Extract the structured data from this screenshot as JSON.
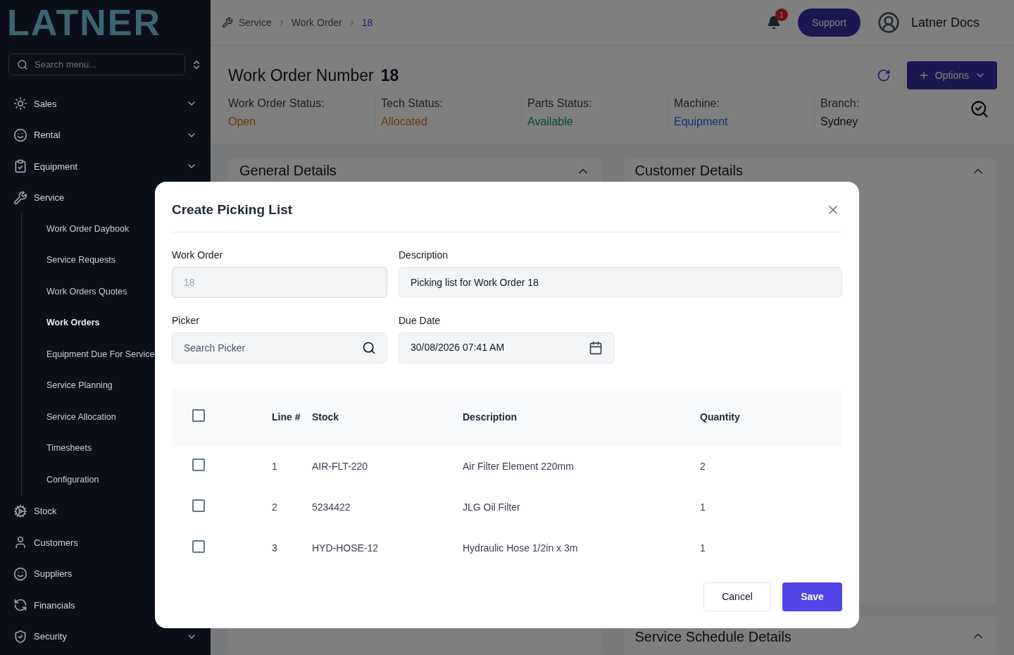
{
  "sidebar": {
    "logo": "LATNER",
    "search": {
      "placeholder": "Search menu..."
    },
    "items": [
      {
        "label": "Sales",
        "expanded": false
      },
      {
        "label": "Rental",
        "expanded": false
      },
      {
        "label": "Equipment",
        "expanded": false
      },
      {
        "label": "Service",
        "expanded": true,
        "children": [
          {
            "label": "Work Order Daybook",
            "selected": false
          },
          {
            "label": "Service Requests",
            "selected": false
          },
          {
            "label": "Work Orders Quotes",
            "selected": false
          },
          {
            "label": "Work Orders",
            "selected": true
          },
          {
            "label": "Equipment Due For Service",
            "selected": false
          },
          {
            "label": "Service Planning",
            "selected": false
          },
          {
            "label": "Service Allocation",
            "selected": false
          },
          {
            "label": "Timesheets",
            "selected": false
          },
          {
            "label": "Configuration",
            "selected": false
          }
        ]
      },
      {
        "label": "Stock"
      },
      {
        "label": "Customers"
      },
      {
        "label": "Suppliers"
      },
      {
        "label": "Financials"
      },
      {
        "label": "Security",
        "expanded": false
      }
    ]
  },
  "header": {
    "breadcrumbs": [
      "Service",
      "Work Order",
      "18"
    ],
    "notifications": "1",
    "support": "Support",
    "user": "Latner Docs"
  },
  "work_order": {
    "title": "Work Order Number",
    "number": "18",
    "options": "Options",
    "statuses": [
      {
        "label": "Work Order Status:",
        "value": "Open",
        "kind": "warning"
      },
      {
        "label": "Tech Status:",
        "value": "Allocated",
        "kind": "warning"
      },
      {
        "label": "Parts Status:",
        "value": "Available",
        "kind": "success"
      },
      {
        "label": "Machine:",
        "value": "Equipment",
        "kind": "link"
      },
      {
        "label": "Branch:",
        "value": "Sydney",
        "kind": "plain"
      }
    ]
  },
  "cards": {
    "left": "General Details",
    "right": "Customer Details",
    "bottom_right": "Service Schedule Details"
  },
  "dialog": {
    "title": "Create Picking List",
    "work_order": {
      "label": "Work Order",
      "value": "18",
      "disabled": true
    },
    "description": {
      "label": "Description",
      "value": "Picking list for Work Order 18"
    },
    "picker": {
      "label": "Picker",
      "placeholder": "Search Picker"
    },
    "due_date": {
      "label": "Due Date",
      "value": "30/08/2026 07:41 AM"
    },
    "table": {
      "select_all": false,
      "columns": [
        "Line #",
        "Stock",
        "Description",
        "Quantity"
      ],
      "rows": [
        {
          "checked": false,
          "cells": [
            "1",
            "AIR-FLT-220",
            "Air Filter Element 220mm",
            "2"
          ]
        },
        {
          "checked": false,
          "cells": [
            "2",
            "5234422",
            "JLG Oil Filter",
            "1"
          ]
        },
        {
          "checked": false,
          "cells": [
            "3",
            "HYD-HOSE-12",
            "Hydraulic Hose 1/2in x 3m",
            "1"
          ]
        }
      ]
    },
    "buttons": [
      {
        "label": "Cancel",
        "kind": "secondary"
      },
      {
        "label": "Save",
        "kind": "primary"
      }
    ]
  }
}
